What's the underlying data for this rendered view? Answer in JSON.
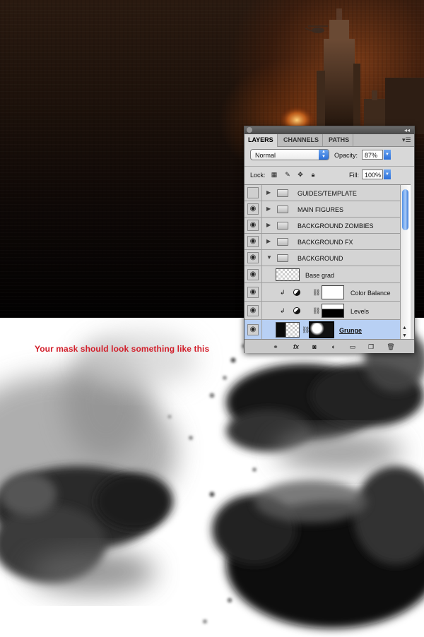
{
  "caption": "Your mask should look something like this",
  "panel": {
    "tabs": [
      "LAYERS",
      "CHANNELS",
      "PATHS"
    ],
    "active_tab": "LAYERS",
    "blend_mode": "Normal",
    "opacity_label": "Opacity:",
    "opacity_value": "87%",
    "lock_label": "Lock:",
    "fill_label": "Fill:",
    "fill_value": "100%",
    "layers": [
      {
        "name": "GUIDES/TEMPLATE",
        "type": "group",
        "visible": false,
        "expanded": false
      },
      {
        "name": "MAIN FIGURES",
        "type": "group",
        "visible": true,
        "expanded": false
      },
      {
        "name": "BACKGROUND ZOMBIES",
        "type": "group",
        "visible": true,
        "expanded": false
      },
      {
        "name": "BACKGROUND FX",
        "type": "group",
        "visible": true,
        "expanded": false
      },
      {
        "name": "BACKGROUND",
        "type": "group",
        "visible": true,
        "expanded": true
      },
      {
        "name": "Base grad",
        "type": "layer",
        "visible": true
      },
      {
        "name": "Color Balance",
        "type": "adjustment",
        "visible": true,
        "clipped": true
      },
      {
        "name": "Levels",
        "type": "adjustment",
        "visible": true,
        "clipped": true
      },
      {
        "name": "Grunge",
        "type": "masked",
        "visible": true,
        "selected": true
      }
    ],
    "footer_icons": [
      "link-icon",
      "fx-icon",
      "add-mask-icon",
      "adjustment-layer-icon",
      "new-group-icon",
      "new-layer-icon",
      "trash-icon"
    ]
  },
  "colors": {
    "caption": "#d21e2a",
    "selection": "#b8d0f4"
  }
}
